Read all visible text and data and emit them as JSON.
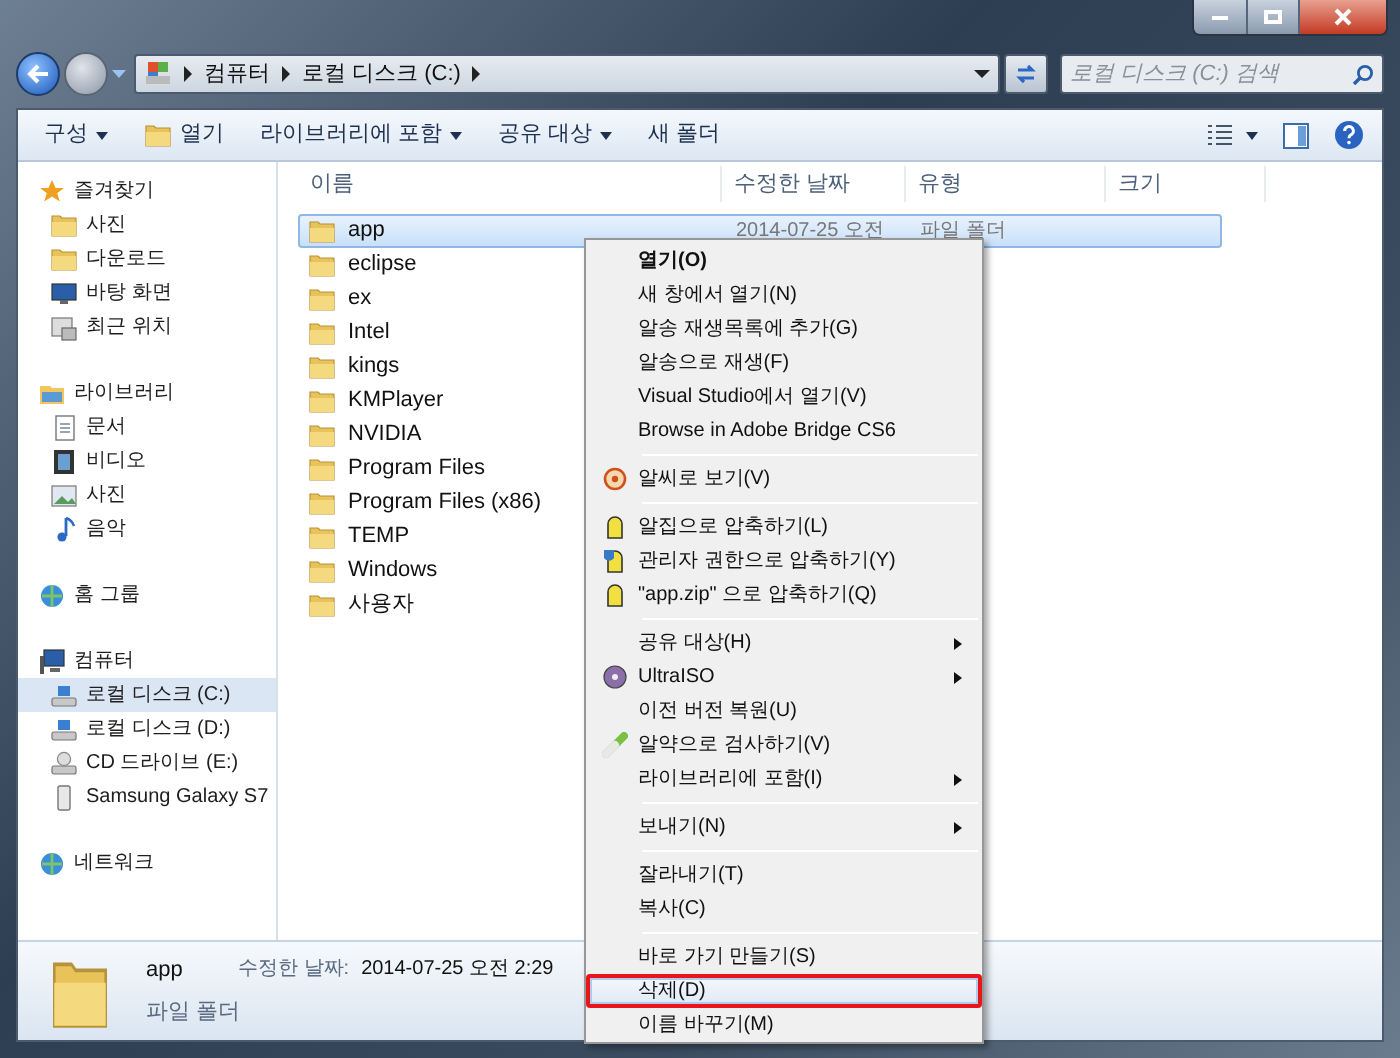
{
  "address_bar": {
    "crumbs": [
      "컴퓨터",
      "로컬 디스크 (C:)"
    ]
  },
  "search": {
    "placeholder": "로컬 디스크 (C:) 검색"
  },
  "toolbar": [
    {
      "label": "구성",
      "kind": "menu"
    },
    {
      "label": "열기",
      "kind": "open"
    },
    {
      "label": "라이브러리에 포함",
      "kind": "menu"
    },
    {
      "label": "공유 대상",
      "kind": "menu"
    },
    {
      "label": "새 폴더",
      "kind": "button"
    }
  ],
  "sidebar": [
    {
      "label": "즐겨찾기",
      "kind": "favorites",
      "selected": false,
      "children": [
        {
          "label": "사진",
          "kind": "folder",
          "selected": false
        },
        {
          "label": "다운로드",
          "kind": "folder",
          "selected": false
        },
        {
          "label": "바탕 화면",
          "kind": "desktop",
          "selected": false
        },
        {
          "label": "최근 위치",
          "kind": "recent",
          "selected": false
        }
      ]
    },
    {
      "label": "라이브러리",
      "kind": "library",
      "selected": false,
      "children": [
        {
          "label": "문서",
          "kind": "documents",
          "selected": false
        },
        {
          "label": "비디오",
          "kind": "videos",
          "selected": false
        },
        {
          "label": "사진",
          "kind": "pictures",
          "selected": false
        },
        {
          "label": "음악",
          "kind": "music",
          "selected": false
        }
      ]
    },
    {
      "label": "홈 그룹",
      "kind": "homegroup",
      "selected": false
    },
    {
      "label": "컴퓨터",
      "kind": "computer",
      "selected": false,
      "children": [
        {
          "label": "로컬 디스크 (C:)",
          "kind": "drive",
          "selected": true
        },
        {
          "label": "로컬 디스크 (D:)",
          "kind": "drive",
          "selected": false
        },
        {
          "label": "CD 드라이브 (E:)",
          "kind": "cd",
          "selected": false
        },
        {
          "label": "Samsung Galaxy S7",
          "kind": "phone",
          "selected": false
        }
      ]
    },
    {
      "label": "네트워크",
      "kind": "network",
      "selected": false
    }
  ],
  "table": {
    "columns": [
      "이름",
      "수정한 날짜",
      "유형",
      "크기"
    ],
    "rows": [
      {
        "name": "app",
        "date": "2014-07-25 오전",
        "type": "파일 폴더",
        "selected": true
      },
      {
        "name": "eclipse",
        "selected": false
      },
      {
        "name": "ex",
        "selected": false
      },
      {
        "name": "Intel",
        "selected": false
      },
      {
        "name": "kings",
        "selected": false
      },
      {
        "name": "KMPlayer",
        "selected": false
      },
      {
        "name": "NVIDIA",
        "selected": false
      },
      {
        "name": "Program Files",
        "selected": false
      },
      {
        "name": "Program Files (x86)",
        "selected": false
      },
      {
        "name": "TEMP",
        "selected": false
      },
      {
        "name": "Windows",
        "selected": false
      },
      {
        "name": "사용자",
        "selected": false
      }
    ]
  },
  "context_menu": [
    {
      "kind": "default",
      "label": "열기(O)",
      "selected": false
    },
    {
      "kind": "item",
      "label": "새 창에서 열기(N)",
      "selected": false
    },
    {
      "kind": "item",
      "label": "알송 재생목록에 추가(G)",
      "selected": false
    },
    {
      "kind": "item",
      "label": "알송으로 재생(F)",
      "selected": false
    },
    {
      "kind": "item",
      "label": "Visual Studio에서 열기(V)",
      "selected": false
    },
    {
      "kind": "item",
      "label": "Browse in Adobe Bridge CS6",
      "selected": false
    },
    {
      "kind": "separator"
    },
    {
      "kind": "viewer",
      "label": "알씨로 보기(V)",
      "selected": false
    },
    {
      "kind": "separator"
    },
    {
      "kind": "zip",
      "label": "알집으로 압축하기(L)",
      "selected": false
    },
    {
      "kind": "zip-admin",
      "label": "관리자 권한으로 압축하기(Y)",
      "selected": false
    },
    {
      "kind": "zip",
      "label": "\"app.zip\" 으로 압축하기(Q)",
      "selected": false
    },
    {
      "kind": "separator"
    },
    {
      "kind": "submenu",
      "label": "공유 대상(H)",
      "selected": false
    },
    {
      "kind": "disc-submenu",
      "label": "UltraISO",
      "selected": false
    },
    {
      "kind": "item",
      "label": "이전 버전 복원(U)",
      "selected": false
    },
    {
      "kind": "scan",
      "label": "알약으로 검사하기(V)",
      "selected": false
    },
    {
      "kind": "submenu",
      "label": "라이브러리에 포함(I)",
      "selected": false
    },
    {
      "kind": "separator"
    },
    {
      "kind": "submenu",
      "label": "보내기(N)",
      "selected": false
    },
    {
      "kind": "separator"
    },
    {
      "kind": "item",
      "label": "잘라내기(T)",
      "selected": false
    },
    {
      "kind": "item",
      "label": "복사(C)",
      "selected": false
    },
    {
      "kind": "separator"
    },
    {
      "kind": "item",
      "label": "바로 가기 만들기(S)",
      "selected": false
    },
    {
      "kind": "item",
      "label": "삭제(D)",
      "selected": true,
      "marked": true
    },
    {
      "kind": "item",
      "label": "이름 바꾸기(M)",
      "selected": false
    }
  ],
  "details_pane": {
    "name": "app",
    "type": "파일 폴더",
    "modified_label": "수정한 날짜:",
    "modified": "2014-07-25 오전 2:29"
  }
}
